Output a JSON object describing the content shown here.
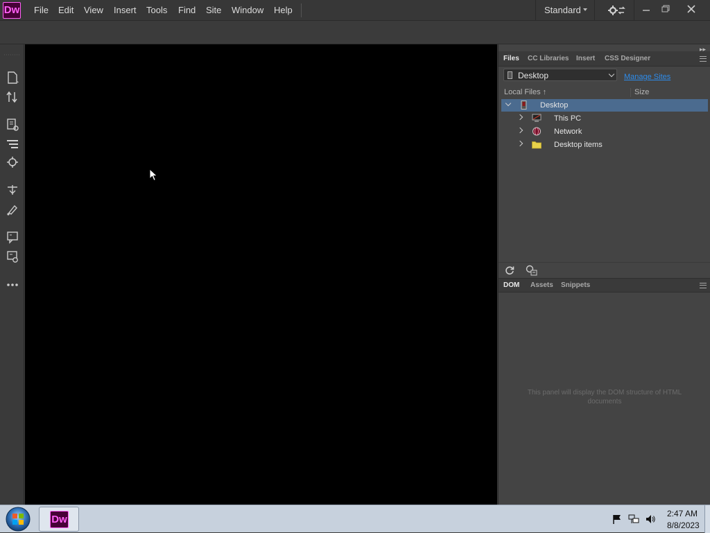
{
  "app": {
    "logo_text": "Dw",
    "menu": [
      "File",
      "Edit",
      "View",
      "Insert",
      "Tools",
      "Find",
      "Site",
      "Window",
      "Help"
    ],
    "workspace": "Standard"
  },
  "files_panel": {
    "tabs": [
      "Files",
      "CC Libraries",
      "Insert",
      "CSS Designer"
    ],
    "active_tab": "Files",
    "site_select": "Desktop",
    "manage_sites": "Manage Sites",
    "col_local": "Local Files ↑",
    "col_size": "Size",
    "tree": [
      {
        "label": "Desktop",
        "icon": "desktop-icon",
        "expanded": true,
        "selected": true
      },
      {
        "label": "This PC",
        "icon": "computer-icon",
        "expanded": false
      },
      {
        "label": "Network",
        "icon": "network-icon",
        "expanded": false
      },
      {
        "label": "Desktop items",
        "icon": "folder-icon",
        "expanded": false
      }
    ]
  },
  "dom_panel": {
    "tabs": [
      "DOM",
      "Assets",
      "Snippets"
    ],
    "active_tab": "DOM",
    "message": "This panel will display the DOM structure of HTML documents"
  },
  "taskbar": {
    "task_logo": "Dw",
    "time": "2:47 AM",
    "date": "8/8/2023"
  },
  "colors": {
    "brand": "#ff61f6",
    "brand_bg": "#470137",
    "link": "#2d8ceb",
    "selection": "#4b6b8f"
  }
}
